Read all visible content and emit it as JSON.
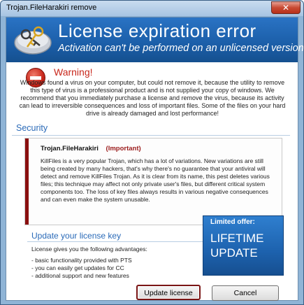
{
  "window": {
    "title": "Trojan.FileHarakiri remove",
    "close_glyph": "✕"
  },
  "banner": {
    "title": "License expiration error",
    "subtitle": "Activation can't be performed on an unlicensed version",
    "icon": "keys-icon"
  },
  "warning": {
    "icon": "stop-icon",
    "title": "Warning!",
    "text": "Windows found a virus on your computer, but could not remove it, because the utility to remove this type of virus is a professional product and is not supplied your copy of windows. We recommend that you immediately purchase a license and remove the  virus, because its activity can lead to irreversible consequences and loss of important files. Some of the files on your hard drive is already damaged and lost performance!"
  },
  "security": {
    "title": "Security",
    "threat_name": "Trojan.FileHarakiri",
    "threat_level": "(Important)",
    "description": "KillFiles is a very popular Trojan, which has a lot of variations. New variations are still being created by many hackers, that's why there's no guarantee that your antiviral will detect and remove KillFiles Trojan. As it is clear from its name, this pest deletes various files; this technique may affect not only private user's files, but different critical system components too. The loss of key files always results in various negative consequences and can even make the system unusable."
  },
  "license": {
    "title": "Update your license key",
    "intro": "License gives you the following advantages:",
    "items": [
      "- basic functionality provided with PTS",
      "- you can easily get updates for CC",
      "- additional support and new features"
    ]
  },
  "offer": {
    "label": "Limited offer:",
    "line1": "LIFETIME",
    "line2": "UPDATE"
  },
  "buttons": {
    "update": "Update license",
    "cancel": "Cancel"
  },
  "colors": {
    "banner": "#1b5ea8",
    "warning_red": "#c8261a",
    "section_blue": "#2a6ab8",
    "threat_bar": "#8a0f0f"
  }
}
